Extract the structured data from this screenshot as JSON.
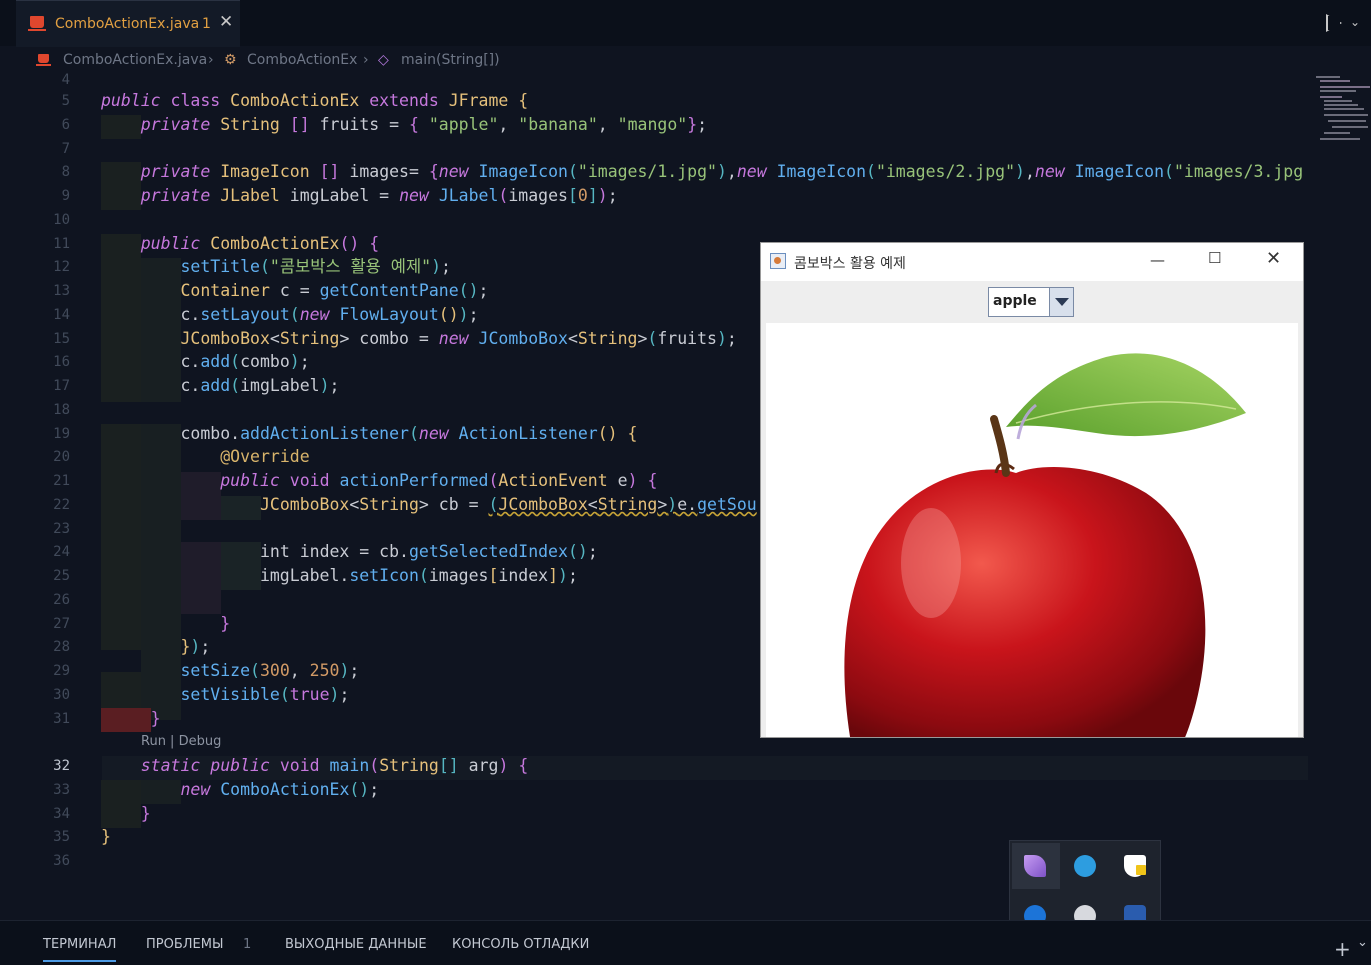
{
  "tabs": [
    {
      "label": "ComboActionEx.java",
      "problems": "1"
    }
  ],
  "breadcrumb": {
    "file": "ComboActionEx.java",
    "class": "ComboActionEx",
    "method": "main(String[])"
  },
  "codelens": "Run | Debug",
  "line_numbers": [
    "4",
    "5",
    "6",
    "7",
    "8",
    "9",
    "10",
    "11",
    "12",
    "13",
    "14",
    "15",
    "16",
    "17",
    "18",
    "19",
    "20",
    "21",
    "22",
    "23",
    "24",
    "25",
    "26",
    "27",
    "28",
    "29",
    "30",
    "31",
    "32",
    "33",
    "34",
    "35",
    "36"
  ],
  "current_line": "32",
  "java_window": {
    "title": "콤보박스 활용 예제",
    "combo_value": "apple",
    "image": "red apple photo"
  },
  "panel_tabs": [
    "ТЕРМИНАЛ",
    "ПРОБЛЕМЫ",
    "ВЫХОДНЫЕ ДАННЫЕ",
    "КОНСОЛЬ ОТЛАДКИ"
  ],
  "problems_count": "1",
  "tray_icons": [
    "feather-icon",
    "telegram-icon",
    "shield-warning-icon",
    "bluetooth-icon",
    "disk-icon",
    "tools-icon"
  ],
  "colors": {
    "editor_bg": "#0f1420",
    "keyword": "#c678dd",
    "type": "#e5c07b",
    "function": "#61afef",
    "string": "#98c379",
    "number": "#d19a66",
    "tab_text": "#e2a042"
  }
}
